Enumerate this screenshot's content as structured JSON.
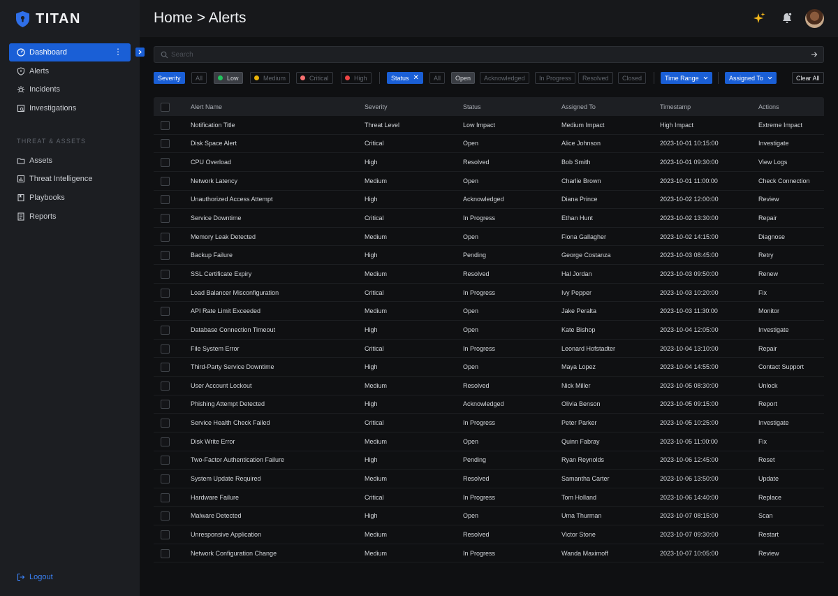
{
  "app": {
    "name": "TITAN"
  },
  "sidebar": {
    "primary": [
      {
        "label": "Dashboard",
        "icon": "dashboard-icon"
      },
      {
        "label": "Alerts",
        "icon": "shield-icon"
      },
      {
        "label": "Incidents",
        "icon": "bug-icon"
      },
      {
        "label": "Investigations",
        "icon": "investigation-icon"
      }
    ],
    "section_label": "THREAT & ASSETS",
    "secondary": [
      {
        "label": "Assets",
        "icon": "folder-icon"
      },
      {
        "label": "Threat Intelligence",
        "icon": "chart-icon"
      },
      {
        "label": "Playbooks",
        "icon": "book-icon"
      },
      {
        "label": "Reports",
        "icon": "report-icon"
      }
    ],
    "logout": "Logout"
  },
  "header": {
    "breadcrumb": "Home > Alerts"
  },
  "search": {
    "placeholder": "Search"
  },
  "filters": {
    "severity": "Severity",
    "severity_all": "All",
    "low": "Low",
    "medium": "Medium",
    "critical": "Critical",
    "high": "High",
    "status": "Status",
    "status_all": "All",
    "open": "Open",
    "acknowledged": "Acknowledged",
    "in_progress": "In Progress",
    "resolved": "Resolved",
    "closed": "Closed",
    "time_range": "Time Range",
    "assigned_to": "Assigned To",
    "clear_all": "Clear All"
  },
  "colors": {
    "accent": "#1a5fd6",
    "low": "#22c55e",
    "medium": "#eab308",
    "critical": "#f87171",
    "high": "#ef4444"
  },
  "table": {
    "columns": [
      "Alert Name",
      "Severity",
      "Status",
      "Assigned To",
      "Timestamp",
      "Actions"
    ],
    "rows": [
      [
        "Notification Title",
        "Threat Level",
        "Low Impact",
        "Medium Impact",
        "High Impact",
        "Extreme Impact"
      ],
      [
        "Disk Space Alert",
        "Critical",
        "Open",
        "Alice Johnson",
        "2023-10-01 10:15:00",
        "Investigate"
      ],
      [
        "CPU Overload",
        "High",
        "Resolved",
        "Bob Smith",
        "2023-10-01 09:30:00",
        "View Logs"
      ],
      [
        "Network Latency",
        "Medium",
        "Open",
        "Charlie Brown",
        "2023-10-01 11:00:00",
        "Check Connection"
      ],
      [
        "Unauthorized Access Attempt",
        "High",
        "Acknowledged",
        "Diana Prince",
        "2023-10-02 12:00:00",
        "Review"
      ],
      [
        "Service Downtime",
        "Critical",
        "In Progress",
        "Ethan Hunt",
        "2023-10-02 13:30:00",
        "Repair"
      ],
      [
        "Memory Leak Detected",
        "Medium",
        "Open",
        "Fiona Gallagher",
        "2023-10-02 14:15:00",
        "Diagnose"
      ],
      [
        "Backup Failure",
        "High",
        "Pending",
        "George Costanza",
        "2023-10-03 08:45:00",
        "Retry"
      ],
      [
        "SSL Certificate Expiry",
        "Medium",
        "Resolved",
        "Hal Jordan",
        "2023-10-03 09:50:00",
        "Renew"
      ],
      [
        "Load Balancer Misconfiguration",
        "Critical",
        "In Progress",
        "Ivy Pepper",
        "2023-10-03 10:20:00",
        "Fix"
      ],
      [
        "API Rate Limit Exceeded",
        "Medium",
        "Open",
        "Jake Peralta",
        "2023-10-03 11:30:00",
        "Monitor"
      ],
      [
        "Database Connection Timeout",
        "High",
        "Open",
        "Kate Bishop",
        "2023-10-04 12:05:00",
        "Investigate"
      ],
      [
        "File System Error",
        "Critical",
        "In Progress",
        "Leonard Hofstadter",
        "2023-10-04 13:10:00",
        "Repair"
      ],
      [
        "Third-Party Service Downtime",
        "High",
        "Open",
        "Maya Lopez",
        "2023-10-04 14:55:00",
        "Contact Support"
      ],
      [
        "User Account Lockout",
        "Medium",
        "Resolved",
        "Nick Miller",
        "2023-10-05 08:30:00",
        "Unlock"
      ],
      [
        "Phishing Attempt Detected",
        "High",
        "Acknowledged",
        "Olivia Benson",
        "2023-10-05 09:15:00",
        "Report"
      ],
      [
        "Service Health Check Failed",
        "Critical",
        "In Progress",
        "Peter Parker",
        "2023-10-05 10:25:00",
        "Investigate"
      ],
      [
        "Disk Write Error",
        "Medium",
        "Open",
        "Quinn Fabray",
        "2023-10-05 11:00:00",
        "Fix"
      ],
      [
        "Two-Factor Authentication Failure",
        "High",
        "Pending",
        "Ryan Reynolds",
        "2023-10-06 12:45:00",
        "Reset"
      ],
      [
        "System Update Required",
        "Medium",
        "Resolved",
        "Samantha Carter",
        "2023-10-06 13:50:00",
        "Update"
      ],
      [
        "Hardware Failure",
        "Critical",
        "In Progress",
        "Tom Holland",
        "2023-10-06 14:40:00",
        "Replace"
      ],
      [
        "Malware Detected",
        "High",
        "Open",
        "Uma Thurman",
        "2023-10-07 08:15:00",
        "Scan"
      ],
      [
        "Unresponsive Application",
        "Medium",
        "Resolved",
        "Victor Stone",
        "2023-10-07 09:30:00",
        "Restart"
      ],
      [
        "Network Configuration Change",
        "Medium",
        "In Progress",
        "Wanda Maximoff",
        "2023-10-07 10:05:00",
        "Review"
      ]
    ]
  }
}
